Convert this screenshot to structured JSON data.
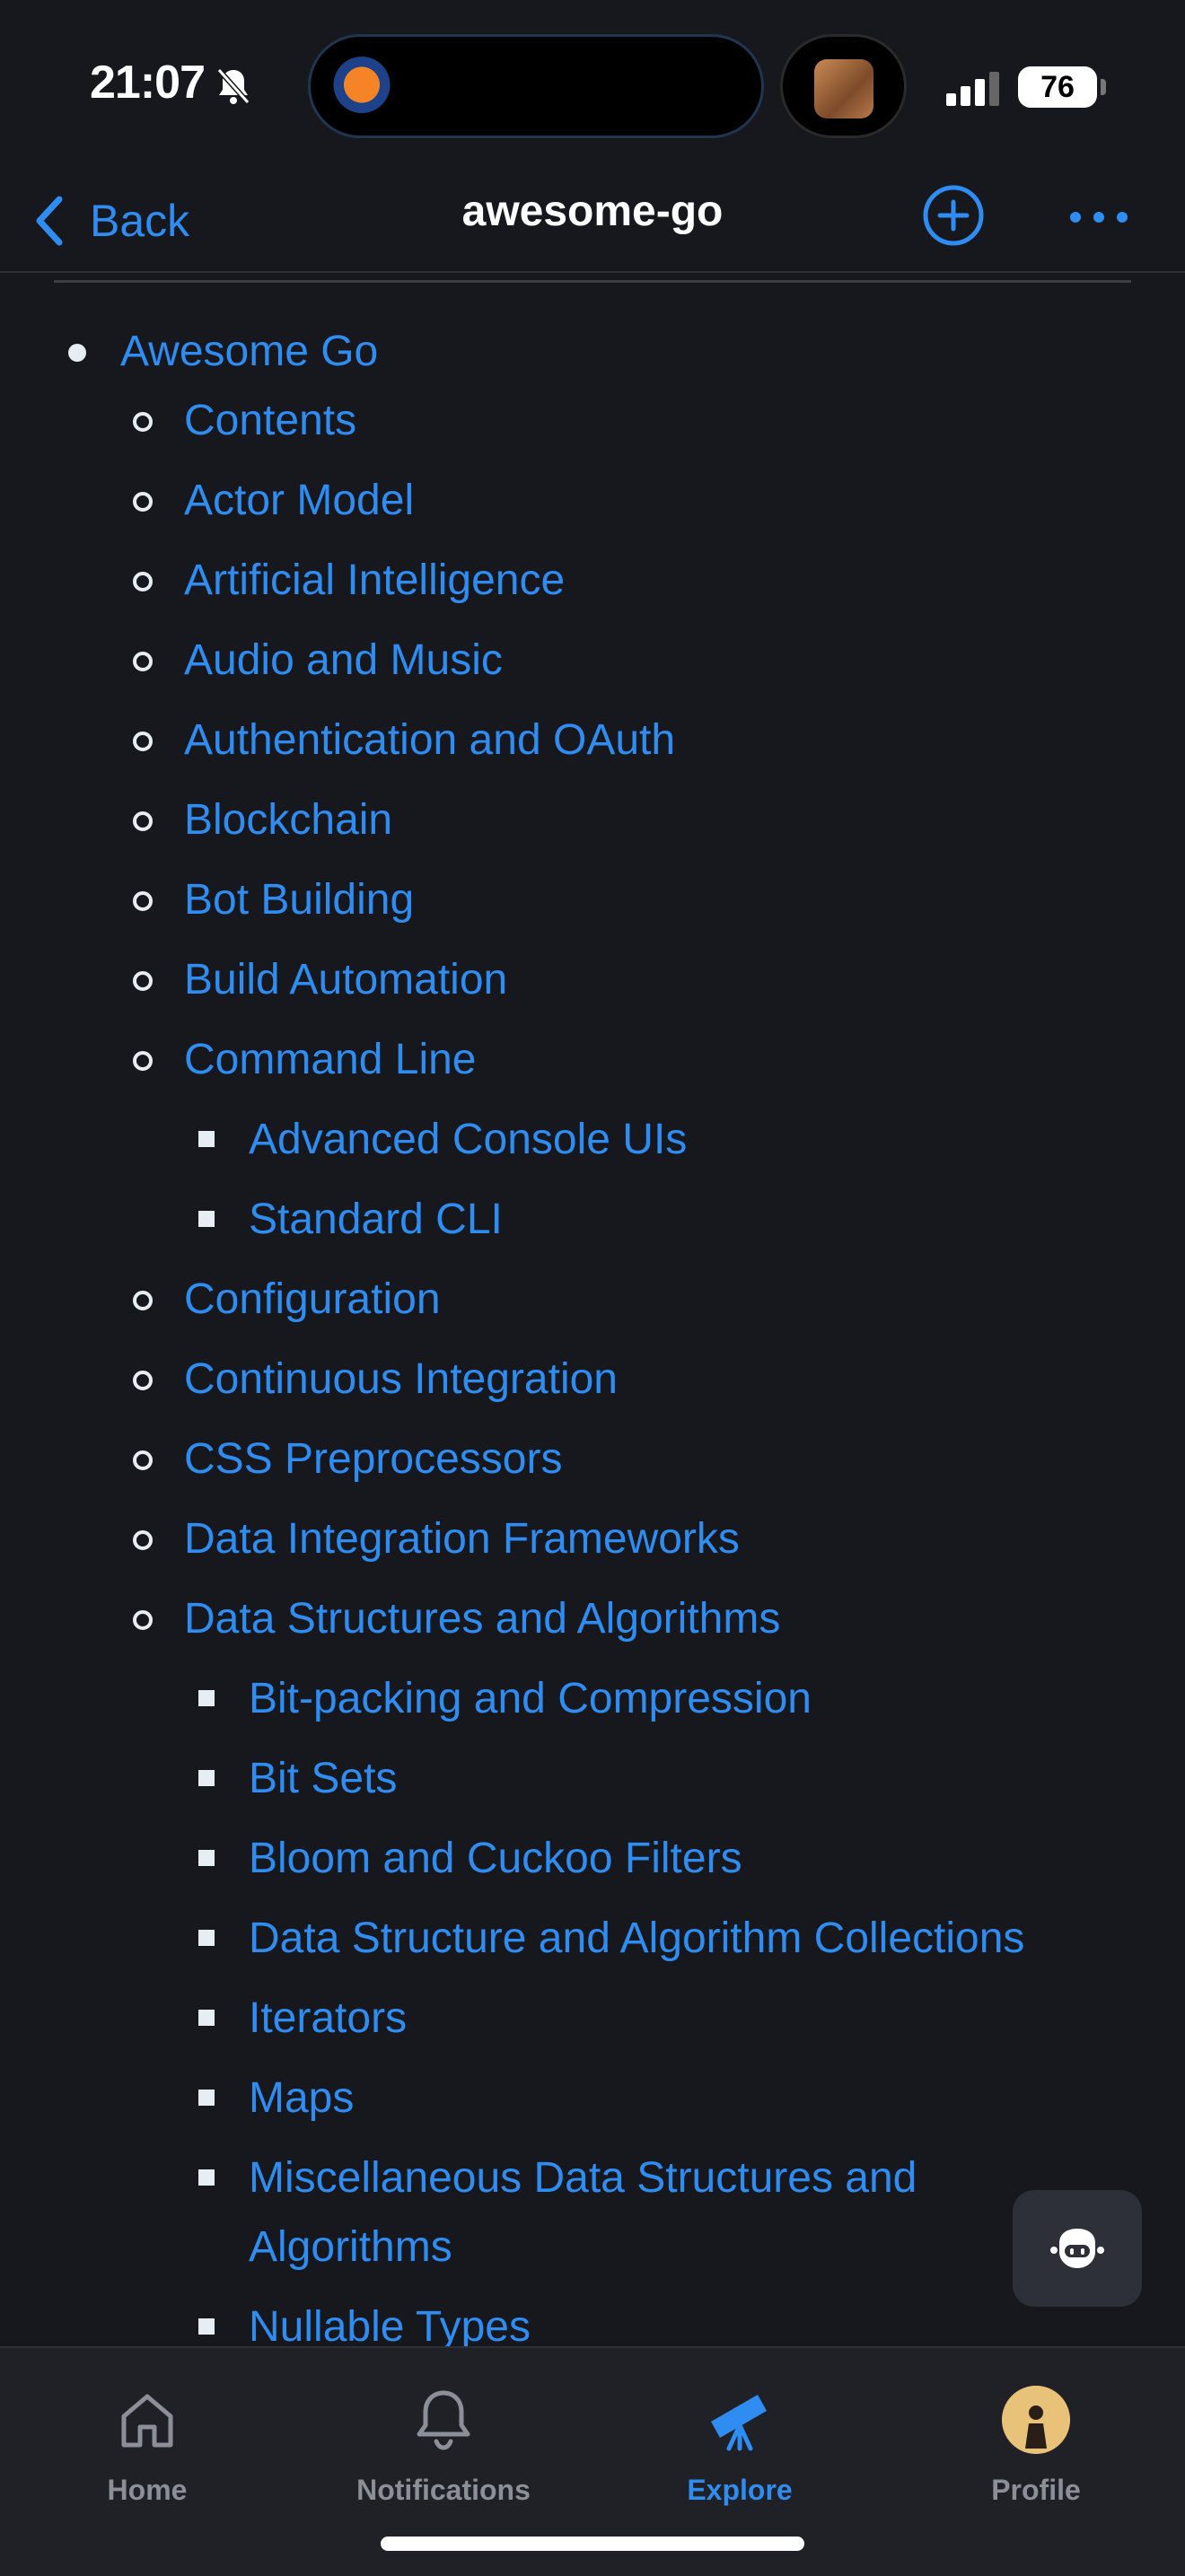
{
  "status": {
    "time": "21:07",
    "battery": "76"
  },
  "nav": {
    "back_label": "Back",
    "title": "awesome-go"
  },
  "toc": {
    "root": "Awesome Go",
    "items": [
      {
        "label": "Contents",
        "level": 2
      },
      {
        "label": "Actor Model",
        "level": 2
      },
      {
        "label": "Artificial Intelligence",
        "level": 2
      },
      {
        "label": "Audio and Music",
        "level": 2
      },
      {
        "label": "Authentication and OAuth",
        "level": 2
      },
      {
        "label": "Blockchain",
        "level": 2
      },
      {
        "label": "Bot Building",
        "level": 2
      },
      {
        "label": "Build Automation",
        "level": 2
      },
      {
        "label": "Command Line",
        "level": 2
      },
      {
        "label": "Advanced Console UIs",
        "level": 3
      },
      {
        "label": "Standard CLI",
        "level": 3
      },
      {
        "label": "Configuration",
        "level": 2
      },
      {
        "label": "Continuous Integration",
        "level": 2
      },
      {
        "label": "CSS Preprocessors",
        "level": 2
      },
      {
        "label": "Data Integration Frameworks",
        "level": 2
      },
      {
        "label": "Data Structures and Algorithms",
        "level": 2
      },
      {
        "label": "Bit-packing and Compression",
        "level": 3
      },
      {
        "label": "Bit Sets",
        "level": 3
      },
      {
        "label": "Bloom and Cuckoo Filters",
        "level": 3
      },
      {
        "label": "Data Structure and Algorithm Collections",
        "level": 3
      },
      {
        "label": "Iterators",
        "level": 3
      },
      {
        "label": "Maps",
        "level": 3
      },
      {
        "label": "Miscellaneous Data Structures and",
        "level": 3
      },
      {
        "label": "Algorithms",
        "level": 3,
        "continuation": true
      },
      {
        "label": "Nullable Types",
        "level": 3
      }
    ]
  },
  "tabs": {
    "home": "Home",
    "notifications": "Notifications",
    "explore": "Explore",
    "profile": "Profile"
  },
  "colors": {
    "link": "#2f8cf1",
    "background": "#16181d",
    "tabbar": "#1f2127"
  }
}
